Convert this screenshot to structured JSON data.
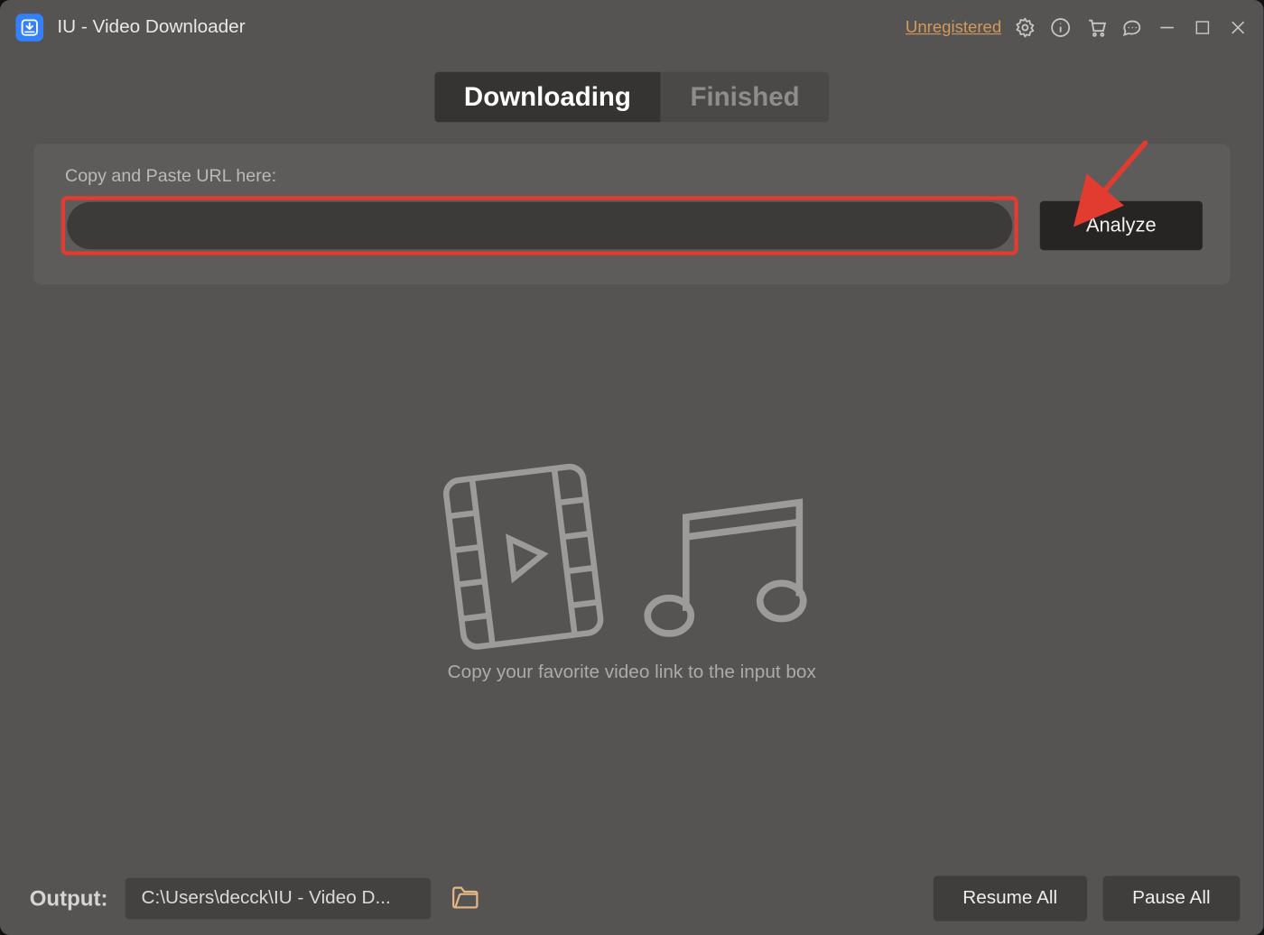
{
  "header": {
    "app_title": "IU - Video Downloader",
    "unregistered_label": "Unregistered"
  },
  "tabs": {
    "downloading": "Downloading",
    "finished": "Finished",
    "active": "downloading"
  },
  "url_panel": {
    "label": "Copy and Paste URL here:",
    "value": "",
    "analyze_label": "Analyze"
  },
  "empty_state": {
    "hint": "Copy your favorite video link to the input box"
  },
  "footer": {
    "output_label": "Output:",
    "output_path": "C:\\Users\\decck\\IU - Video D...",
    "resume_label": "Resume All",
    "pause_label": "Pause All"
  },
  "icons": {
    "settings": "gear-icon",
    "info": "info-icon",
    "cart": "cart-icon",
    "chat": "chat-icon",
    "minimize": "minimize-icon",
    "maximize": "maximize-icon",
    "close": "close-icon",
    "folder": "folder-icon",
    "film": "film-icon",
    "music": "music-note-icon",
    "app": "download-badge-icon",
    "arrow": "annotation-arrow"
  },
  "colors": {
    "accent": "#3481ff",
    "warning_link": "#d39a5b",
    "highlight_box": "#e23b2f",
    "button_dark": "#262523"
  }
}
